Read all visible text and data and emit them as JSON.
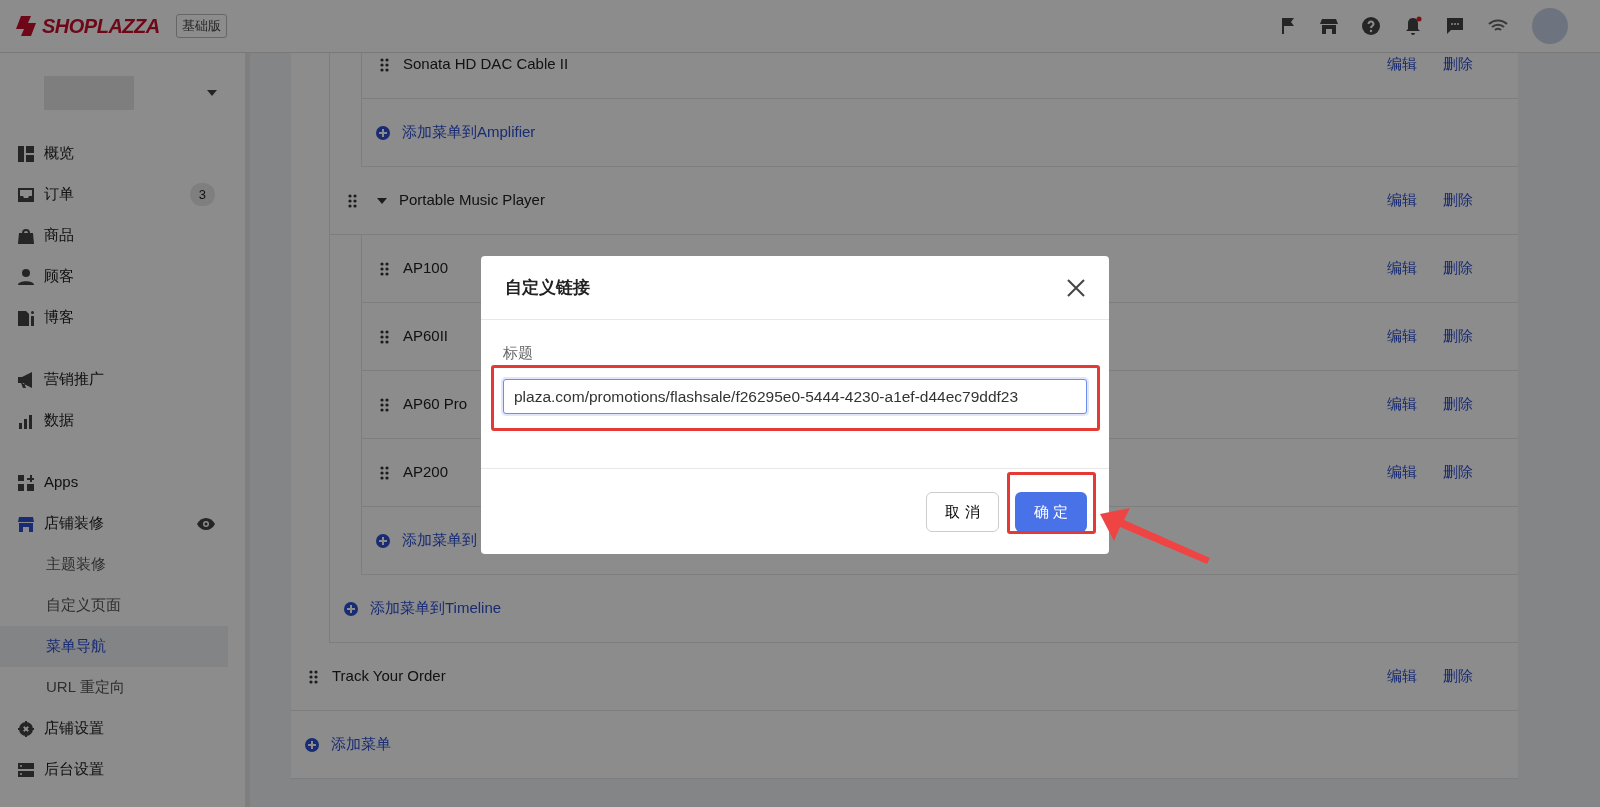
{
  "brand": {
    "logo": "SHOPLAZZA",
    "plan_badge": "基础版"
  },
  "topbar": {
    "bell_unread": true
  },
  "sidebar": {
    "sections": [
      [
        {
          "label": "概览"
        },
        {
          "label": "订单",
          "badge": "3"
        },
        {
          "label": "商品"
        },
        {
          "label": "顾客"
        },
        {
          "label": "博客"
        }
      ],
      [
        {
          "label": "营销推广"
        },
        {
          "label": "数据"
        }
      ],
      [
        {
          "label": "Apps"
        },
        {
          "label": "店铺装修",
          "expanded": true,
          "children": [
            {
              "label": "主题装修",
              "selected": false
            },
            {
              "label": "自定义页面",
              "selected": false
            },
            {
              "label": "菜单导航",
              "selected": true
            },
            {
              "label": "URL 重定向",
              "selected": false
            }
          ]
        },
        {
          "label": "店铺设置"
        },
        {
          "label": "后台设置"
        }
      ]
    ]
  },
  "menu_rows": [
    {
      "kind": "group",
      "children": [
        {
          "kind": "group",
          "children": [
            {
              "kind": "item",
              "label": "Sonata HD DAC Cable II",
              "edit": "编辑",
              "delete": "删除"
            },
            {
              "kind": "add",
              "label": "添加菜单到Amplifier"
            }
          ]
        },
        {
          "kind": "item",
          "label": "Portable Music Player",
          "expanded": true,
          "edit": "编辑",
          "delete": "删除",
          "children": [
            {
              "kind": "item",
              "label": "AP100",
              "edit": "编辑",
              "delete": "删除"
            },
            {
              "kind": "item",
              "label": "AP60II",
              "edit": "编辑",
              "delete": "删除"
            },
            {
              "kind": "item",
              "label": "AP60 Pro",
              "edit": "编辑",
              "delete": "删除"
            },
            {
              "kind": "item",
              "label": "AP200",
              "edit": "编辑",
              "delete": "删除"
            },
            {
              "kind": "add",
              "label": "添加菜单到"
            }
          ]
        },
        {
          "kind": "add",
          "label": "添加菜单到Timeline"
        }
      ]
    },
    {
      "kind": "item",
      "label": "Track Your Order",
      "edit": "编辑",
      "delete": "删除"
    },
    {
      "kind": "add",
      "label": "添加菜单"
    }
  ],
  "modal": {
    "title": "自定义链接",
    "field_label": "标题",
    "field_value": "plaza.com/promotions/flashsale/f26295e0-5444-4230-a1ef-d44ec79ddf23",
    "cancel": "取 消",
    "confirm": "确 定"
  }
}
